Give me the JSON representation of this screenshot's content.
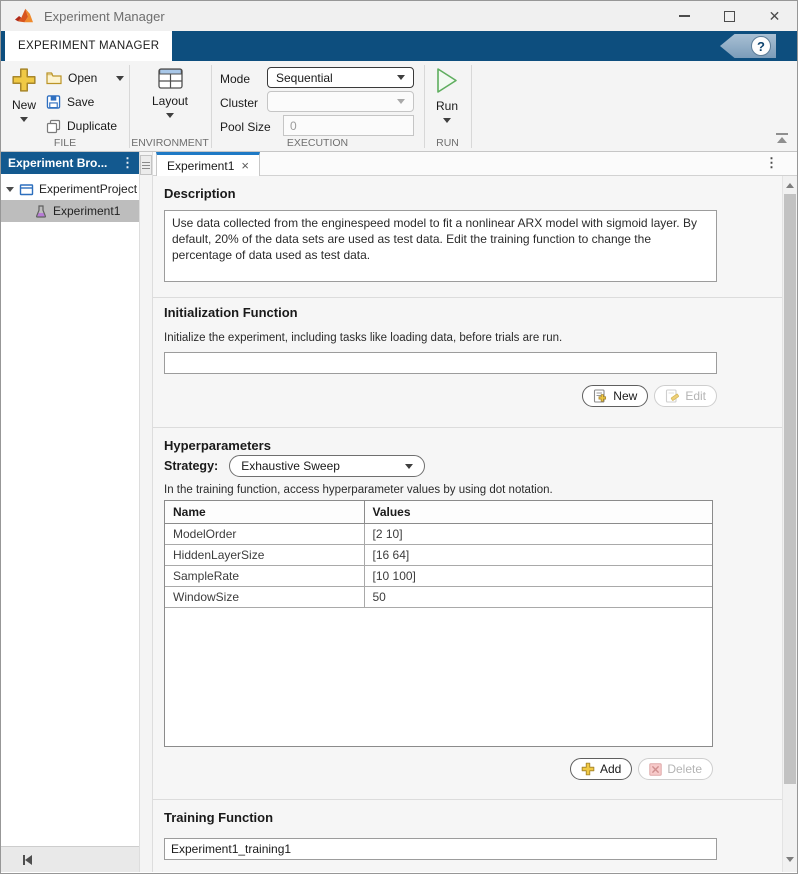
{
  "window": {
    "title": "Experiment Manager"
  },
  "icons": {
    "close_window": "✕",
    "overflow_menu": "⋮",
    "tab_close": "×",
    "help": "?"
  },
  "ribbon": {
    "tab_label": "EXPERIMENT MANAGER",
    "file": {
      "section_label": "FILE",
      "new_label": "New",
      "open_label": "Open",
      "save_label": "Save",
      "duplicate_label": "Duplicate"
    },
    "environment": {
      "section_label": "ENVIRONMENT",
      "layout_label": "Layout"
    },
    "execution": {
      "section_label": "EXECUTION",
      "mode_label": "Mode",
      "mode_value": "Sequential",
      "cluster_label": "Cluster",
      "cluster_value": "",
      "pool_size_label": "Pool Size",
      "pool_size_value": "0"
    },
    "run": {
      "section_label": "RUN",
      "run_label": "Run"
    }
  },
  "experiment_browser": {
    "header": "Experiment Bro...",
    "project_label": "ExperimentProject",
    "experiment_label": "Experiment1"
  },
  "document": {
    "tab_label": "Experiment1",
    "description": {
      "heading": "Description",
      "text": "Use data collected from the enginespeed model to fit a nonlinear ARX model with sigmoid layer. By default, 20% of the data sets are used as test data. Edit the training function to change the percentage of data used as test data."
    },
    "initialization": {
      "heading": "Initialization Function",
      "hint": "Initialize the experiment, including tasks like loading data, before trials are run.",
      "value": "",
      "new_label": "New",
      "edit_label": "Edit"
    },
    "hyperparameters": {
      "heading": "Hyperparameters",
      "strategy_label": "Strategy:",
      "strategy_value": "Exhaustive Sweep",
      "hint": "In the training function, access hyperparameter values by using dot notation.",
      "table": {
        "headers": [
          "Name",
          "Values"
        ],
        "rows": [
          {
            "name": "ModelOrder",
            "values": "[2 10]"
          },
          {
            "name": "HiddenLayerSize",
            "values": "[16 64]"
          },
          {
            "name": "SampleRate",
            "values": "[10 100]"
          },
          {
            "name": "WindowSize",
            "values": "50"
          }
        ]
      },
      "add_label": "Add",
      "delete_label": "Delete"
    },
    "training": {
      "heading": "Training Function",
      "value": "Experiment1_training1"
    }
  },
  "colors": {
    "toolstrip_blue": "#0d4e7e",
    "panel_header_blue": "#13598f",
    "active_tab_accent": "#1f7ac5",
    "run_green": "#5fae5f",
    "plus_yellow": "#f0c945",
    "selected_row_gray": "#bdbdbd"
  }
}
